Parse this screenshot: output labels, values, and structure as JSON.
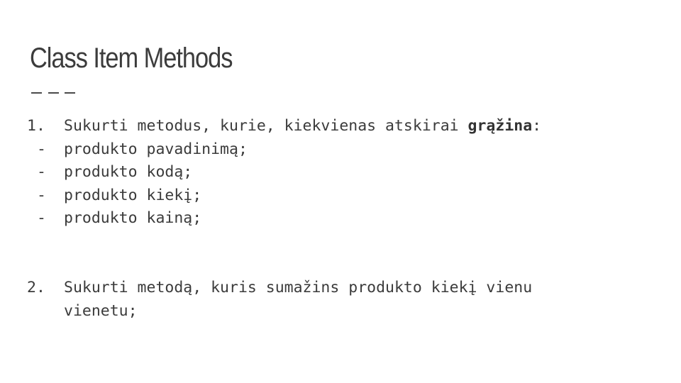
{
  "slide": {
    "title": "Class Item Methods",
    "item1": {
      "marker": "1.",
      "prefix": "Sukurti metodus, kurie, kiekvienas atskirai ",
      "emphasis": "grąžina",
      "suffix": ":"
    },
    "subitems": [
      {
        "marker": "-",
        "text": "produkto pavadinimą;"
      },
      {
        "marker": "-",
        "text": "produkto kodą;"
      },
      {
        "marker": "-",
        "text": "produkto kiekį;"
      },
      {
        "marker": "-",
        "text": "produkto kainą;"
      }
    ],
    "item2": {
      "marker": "2.",
      "line1": "Sukurti metodą, kuris sumažins produkto kiekį vienu",
      "line2": "vienetu;"
    }
  }
}
